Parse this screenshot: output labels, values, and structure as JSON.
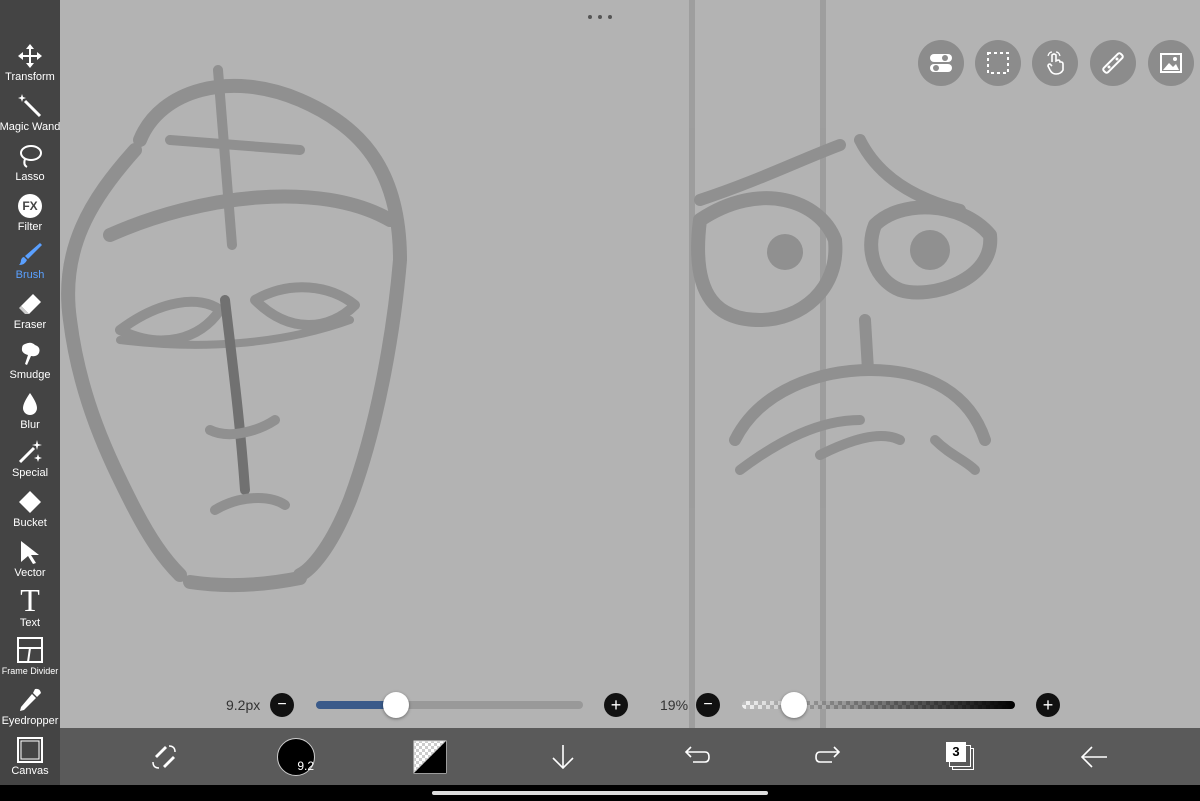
{
  "tools": [
    {
      "label": "Transform",
      "icon": "move-arrows-icon"
    },
    {
      "label": "Magic Wand",
      "icon": "magic-wand-icon"
    },
    {
      "label": "Lasso",
      "icon": "lasso-icon"
    },
    {
      "label": "Filter",
      "icon": "fx-icon",
      "glyph": "FX"
    },
    {
      "label": "Brush",
      "icon": "brush-icon",
      "active": true
    },
    {
      "label": "Eraser",
      "icon": "eraser-icon"
    },
    {
      "label": "Smudge",
      "icon": "smudge-icon"
    },
    {
      "label": "Blur",
      "icon": "droplet-icon"
    },
    {
      "label": "Special",
      "icon": "sparkle-icon"
    },
    {
      "label": "Bucket",
      "icon": "bucket-icon"
    },
    {
      "label": "Vector",
      "icon": "cursor-arrow-icon"
    },
    {
      "label": "Text",
      "icon": "text-t-icon",
      "glyph": "T"
    },
    {
      "label": "Frame Divider",
      "icon": "frame-divider-icon"
    },
    {
      "label": "Eyedropper",
      "icon": "eyedropper-icon"
    },
    {
      "label": "Canvas",
      "icon": "canvas-square-icon"
    }
  ],
  "top_buttons": [
    "toggle-icon",
    "selection-icon",
    "touch-gesture-icon",
    "ruler-icon",
    "image-icon"
  ],
  "brush_size": {
    "label": "9.2px",
    "value_fraction": 0.3,
    "minus": "−",
    "plus": "+"
  },
  "opacity": {
    "label": "19%",
    "value_fraction": 0.19,
    "minus": "−",
    "plus": "+"
  },
  "bottom_bar": {
    "brush_size_badge": "9.2",
    "layers_count": "3",
    "icons": [
      "swap-tools-icon",
      "brush-size-icon",
      "color-swatch-icon",
      "download-arrow-icon",
      "undo-icon",
      "redo-icon",
      "layers-icon",
      "back-arrow-icon"
    ]
  },
  "colors": {
    "accent": "#5aa0ff",
    "canvas": "#b3b3b3",
    "sidebar": "#444444",
    "slider_fill": "#3a5a8a"
  }
}
